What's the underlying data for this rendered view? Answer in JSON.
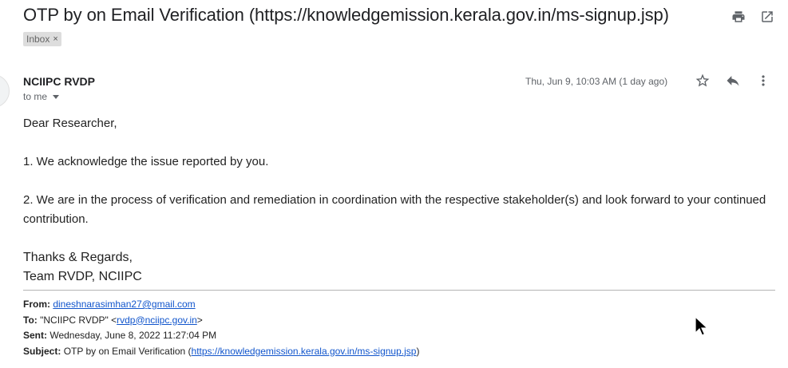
{
  "email": {
    "subject": "OTP by on Email Verification (https://knowledgemission.kerala.gov.in/ms-signup.jsp)",
    "label_chip": "Inbox",
    "label_chip_close": "×",
    "sender_name": "NCIIPC RVDP",
    "to_line": "to me",
    "date": "Thu, Jun 9, 10:03 AM (1 day ago)"
  },
  "icons": {
    "print": "printer-icon",
    "popout": "open-in-new-window-icon",
    "star": "star-icon",
    "reply": "reply-icon",
    "more": "more-vertical-icon"
  },
  "body": {
    "greeting": "Dear Researcher,",
    "para1": "1. We acknowledge the issue reported by you.",
    "para2": "2. We are in the process of verification and remediation in coordination with the respective stakeholder(s) and look forward to your continued contribution.",
    "sig1": "Thanks & Regards,",
    "sig2": "Team RVDP, NCIIPC"
  },
  "forwarded": {
    "from_label": "From:",
    "from_value": "dineshnarasimhan27@gmail.com",
    "to_label": "To:",
    "to_name": "\"NCIIPC RVDP\" <",
    "to_email": "rvdp@nciipc.gov.in",
    "to_close": ">",
    "sent_label": "Sent:",
    "sent_value": "Wednesday, June 8, 2022 11:27:04 PM",
    "subject_label": "Subject:",
    "subject_prefix": "OTP by on Email Verification (",
    "subject_link": "https://knowledgemission.kerala.gov.in/ms-signup.jsp",
    "subject_suffix": ")"
  },
  "colors": {
    "link": "#1155cc",
    "secondary_text": "#5f6368",
    "chip_bg": "#dddddd"
  }
}
